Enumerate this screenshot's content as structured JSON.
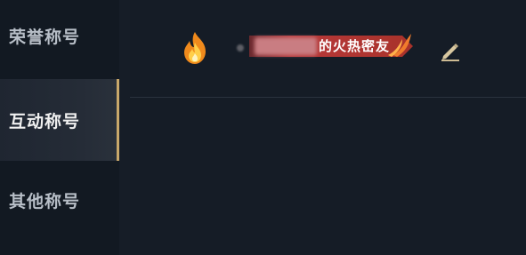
{
  "sidebar": {
    "items": [
      {
        "label": "荣誉称号",
        "active": false
      },
      {
        "label": "互动称号",
        "active": true
      },
      {
        "label": "其他称号",
        "active": false
      }
    ],
    "accent_color": "#c9a86a"
  },
  "main": {
    "title_row": {
      "icon": "flame-icon",
      "banner_text": "的火热密友",
      "banner_color": "#a8322a",
      "edit_icon": "pencil-edit-icon"
    }
  }
}
